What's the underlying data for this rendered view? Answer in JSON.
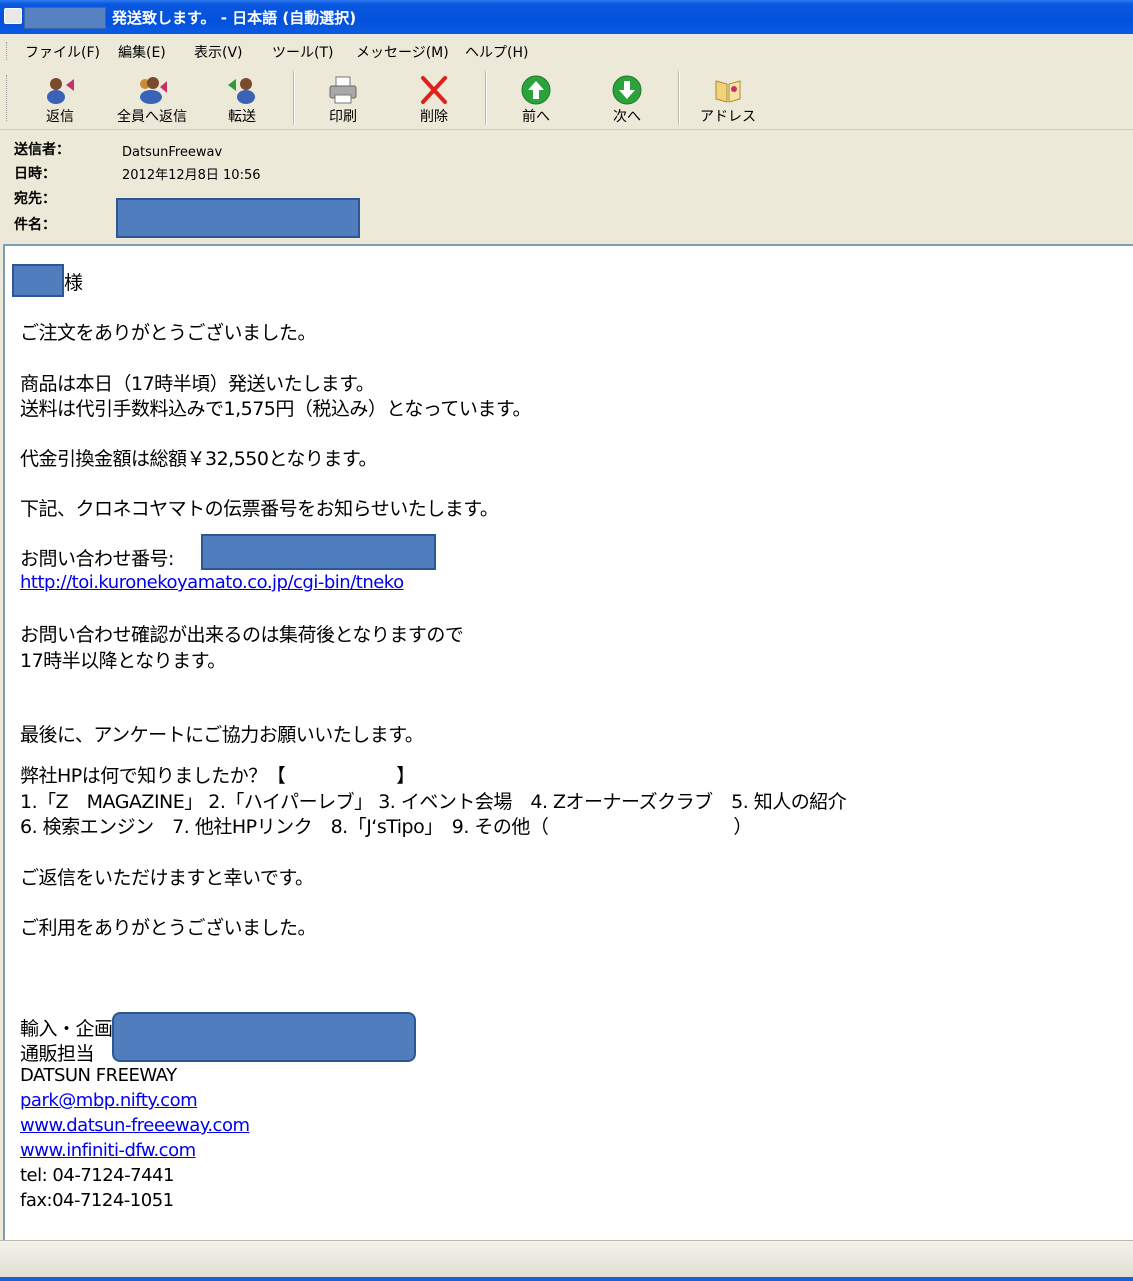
{
  "window": {
    "title": "発送致します。 - 日本語 (自動選択)"
  },
  "menu": [
    {
      "label": "ファイル(F)"
    },
    {
      "label": "編集(E)"
    },
    {
      "label": "表示(V)"
    },
    {
      "label": "ツール(T)"
    },
    {
      "label": "メッセージ(M)"
    },
    {
      "label": "ヘルプ(H)"
    }
  ],
  "toolbar": {
    "reply": "返信",
    "reply_all": "全員へ返信",
    "forward": "転送",
    "print": "印刷",
    "delete": "削除",
    "prev": "前へ",
    "next": "次へ",
    "address": "アドレス"
  },
  "header": {
    "from_label": "送信者：",
    "date_label": "日時：",
    "to_label": "宛先：",
    "subject_label": "件名：",
    "from_value": "DatsunFreewav",
    "date_value": "2012年12月8日 10:56"
  },
  "body": {
    "salutation": "様",
    "l1": "ご注文をありがとうございました。",
    "l2": "商品は本日（17時半頃）発送いたします。",
    "l3": "送料は代引手数料込みで1,575円（税込み）となっています。",
    "l4": "代金引換金額は総額￥32,550となります。",
    "l5": "下記、クロネコヤマトの伝票番号をお知らせいたします。",
    "l6": "お問い合わせ番号:",
    "link1": "http://toi.kuronekoyamato.co.jp/cgi-bin/tneko",
    "l7": "お問い合わせ確認が出来るのは集荷後となりますので",
    "l8": "17時半以降となります。",
    "l9": "最後に、アンケートにご協力お願いいたします。",
    "l10": "弊社HPは何で知りましたか？【　　　　　　】",
    "l11": "1.「Z　MAGAZINE」 2.「ハイパーレブ」 3. イベント会場　4. Zオーナーズクラブ　5. 知人の紹介",
    "l12": "6. 検索エンジン　7. 他社HPリンク　8.「J‘sTipo」　9. その他（　　　　　　　　　　）",
    "l13": "ご返信をいただけますと幸いです。",
    "l14": "ご利用をありがとうございました。",
    "sig1": "輸入・企画",
    "sig2": "通販担当",
    "sig3": "DATSUN FREEWAY",
    "sig_email": "park@mbp.nifty.com",
    "sig_web1": "www.datsun-freeeway.com",
    "sig_web2": "www.infiniti-dfw.com",
    "sig_tel": "tel: 04-7124-7441",
    "sig_fax": "fax:04-7124-1051"
  }
}
